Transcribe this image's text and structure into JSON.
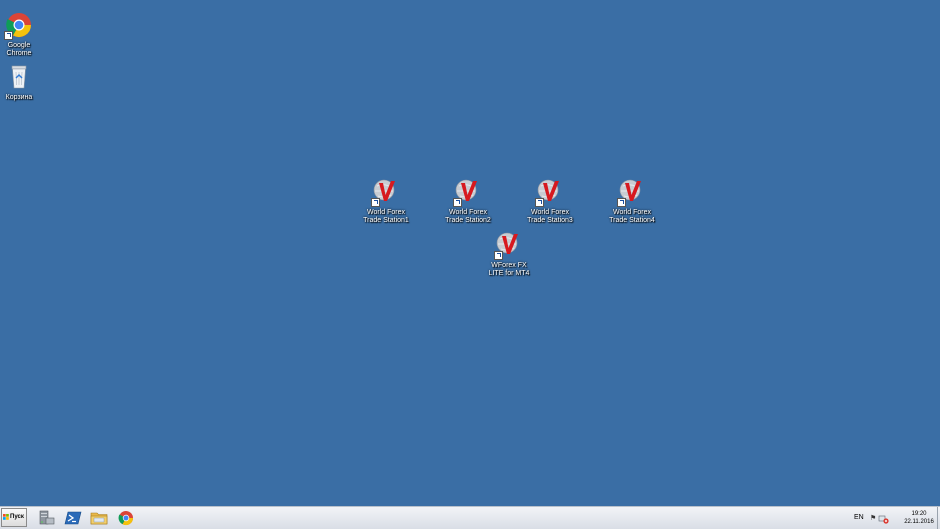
{
  "desktop": {
    "background": "#3a6ea5",
    "icons": [
      {
        "label": "Google\nChrome",
        "icon": "chrome-icon"
      },
      {
        "label": "Корзина",
        "icon": "recycle-bin-icon"
      },
      {
        "label": "World Forex\nTrade Station1",
        "icon": "wforex-icon"
      },
      {
        "label": "World Forex\nTrade Station2",
        "icon": "wforex-icon"
      },
      {
        "label": "World Forex\nTrade Station3",
        "icon": "wforex-icon"
      },
      {
        "label": "World Forex\nTrade Station4",
        "icon": "wforex-icon"
      },
      {
        "label": "WForex FX\nLITE for MT4",
        "icon": "wforex-icon"
      }
    ]
  },
  "taskbar": {
    "start_label": "Пуск",
    "pinned": [
      {
        "icon": "server-manager-icon"
      },
      {
        "icon": "powershell-icon"
      },
      {
        "icon": "file-explorer-icon"
      },
      {
        "icon": "chrome-icon"
      }
    ],
    "language": "EN",
    "tray_flag": "⚑",
    "clock_time": "19:20",
    "clock_date": "22.11.2016"
  }
}
